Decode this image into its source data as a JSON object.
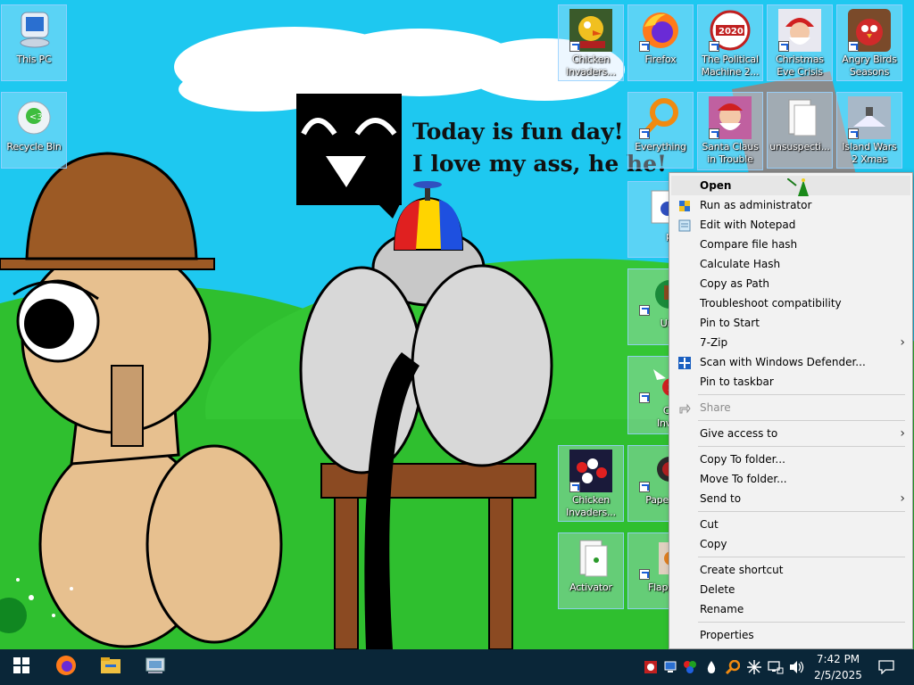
{
  "wallpaper": {
    "speech_line1": "Today is fun day!",
    "speech_line2": "I love my ass, he he!"
  },
  "desktop": {
    "left_icons": [
      {
        "label": "This PC",
        "icon": "computer-icon"
      },
      {
        "label": "Recycle Bin",
        "icon": "recycle-bin-icon"
      }
    ],
    "right_icons": [
      {
        "label": "Chicken Invaders...",
        "icon": "chicken-invaders-icon",
        "shortcut": true
      },
      {
        "label": "Firefox",
        "icon": "firefox-icon",
        "shortcut": true
      },
      {
        "label": "The Political Machine 2...",
        "icon": "political-machine-icon",
        "shortcut": true
      },
      {
        "label": "Christmas Eve Crisis",
        "icon": "santa-icon",
        "shortcut": true
      },
      {
        "label": "Angry Birds Seasons",
        "icon": "angry-birds-icon",
        "shortcut": true
      },
      {
        "label": "Everything",
        "icon": "magnifier-icon",
        "shortcut": true
      },
      {
        "label": "Santa Claus in Trouble",
        "icon": "santa-trouble-icon",
        "shortcut": true
      },
      {
        "label": "unsuspecti...",
        "icon": "document-icon",
        "shortcut": false
      },
      {
        "label": "Island Wars 2 Xmas",
        "icon": "island-wars-icon",
        "shortcut": true
      },
      {
        "label": "popc",
        "icon": "popcorn-icon",
        "shortcut": false
      },
      {
        "label": "Under",
        "icon": "undertale-icon",
        "shortcut": true
      },
      {
        "label": "Chick Invade",
        "icon": "chicken-invaders-2-icon",
        "shortcut": true
      },
      {
        "label": "Chicken Invaders...",
        "icon": "chicken-invaders-pool-icon",
        "shortcut": true
      },
      {
        "label": "Papers, P",
        "icon": "papers-please-icon",
        "shortcut": true
      },
      {
        "label": "Activator",
        "icon": "document-icon",
        "shortcut": false
      },
      {
        "label": "Flappy B",
        "icon": "flappy-icon",
        "shortcut": true
      }
    ]
  },
  "context_menu": {
    "items": [
      {
        "label": "Open",
        "bold": true
      },
      {
        "label": "Run as administrator",
        "icon": "shield-icon"
      },
      {
        "label": "Edit with Notepad",
        "icon": "notepad-icon"
      },
      {
        "label": "Compare file hash"
      },
      {
        "label": "Calculate Hash"
      },
      {
        "label": "Copy as Path"
      },
      {
        "label": "Troubleshoot compatibility"
      },
      {
        "label": "Pin to Start"
      },
      {
        "label": "7-Zip",
        "submenu": true
      },
      {
        "label": "Scan with Windows Defender...",
        "icon": "defender-icon"
      },
      {
        "label": "Pin to taskbar"
      },
      {
        "label": "Share",
        "icon": "share-icon",
        "disabled": true
      },
      {
        "label": "Give access to",
        "submenu": true
      },
      {
        "label": "Copy To folder..."
      },
      {
        "label": "Move To folder..."
      },
      {
        "label": "Send to",
        "submenu": true
      },
      {
        "label": "Cut"
      },
      {
        "label": "Copy"
      },
      {
        "label": "Create shortcut"
      },
      {
        "label": "Delete"
      },
      {
        "label": "Rename"
      },
      {
        "label": "Properties"
      }
    ],
    "submenu_arrow": "›"
  },
  "taskbar": {
    "pinned": [
      "start-icon",
      "firefox-icon",
      "file-explorer-icon",
      "control-panel-icon"
    ],
    "tray_icons": [
      "defender-tray-icon",
      "monitor-tray-icon",
      "colorful-tray-icon",
      "droplet-tray-icon",
      "search-tray-icon",
      "snowflake-tray-icon",
      "network-icon",
      "volume-icon"
    ],
    "time": "7:42 PM",
    "date": "2/5/2025",
    "notification": "notification-icon"
  },
  "colors": {
    "sky": "#1ec8f0",
    "grass": "#2fbf2f",
    "taskbar": "#0a2638",
    "menu_bg": "#f2f2f2"
  }
}
